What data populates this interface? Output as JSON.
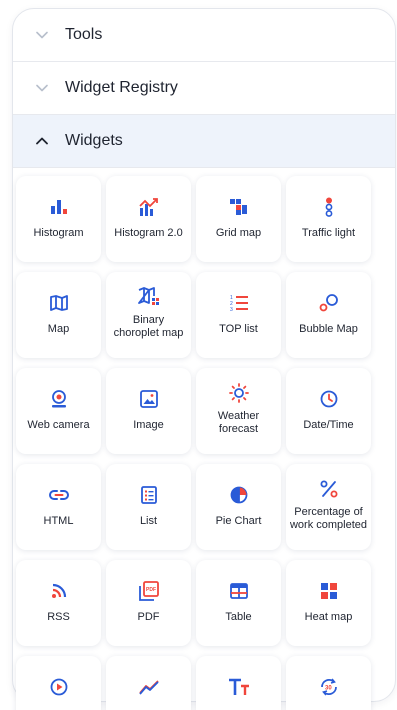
{
  "sections": {
    "tools": {
      "label": "Tools",
      "expanded": false
    },
    "registry": {
      "label": "Widget Registry",
      "expanded": false
    },
    "widgets": {
      "label": "Widgets",
      "expanded": true
    }
  },
  "colors": {
    "blue": "#2a5bd7",
    "red": "#f0463c",
    "header_active": "#eef3fb"
  },
  "widgets": [
    {
      "label": "Histogram",
      "icon": "histogram-icon"
    },
    {
      "label": "Histogram 2.0",
      "icon": "histogram-trend-icon"
    },
    {
      "label": "Grid map",
      "icon": "grid-map-icon"
    },
    {
      "label": "Traffic light",
      "icon": "traffic-light-icon"
    },
    {
      "label": "Map",
      "icon": "map-icon"
    },
    {
      "label": "Binary choroplet map",
      "icon": "choropleth-map-icon"
    },
    {
      "label": "TOP list",
      "icon": "top-list-icon"
    },
    {
      "label": "Bubble Map",
      "icon": "bubble-map-icon"
    },
    {
      "label": "Web camera",
      "icon": "web-camera-icon"
    },
    {
      "label": "Image",
      "icon": "image-icon"
    },
    {
      "label": "Weather forecast",
      "icon": "sun-icon"
    },
    {
      "label": "Date/Time",
      "icon": "clock-icon"
    },
    {
      "label": "HTML",
      "icon": "link-icon"
    },
    {
      "label": "List",
      "icon": "list-icon"
    },
    {
      "label": "Pie Chart",
      "icon": "pie-chart-icon"
    },
    {
      "label": "Percentage of work completed",
      "icon": "percent-icon"
    },
    {
      "label": "RSS",
      "icon": "rss-icon"
    },
    {
      "label": "PDF",
      "icon": "pdf-icon"
    },
    {
      "label": "Table",
      "icon": "table-icon"
    },
    {
      "label": "Heat map",
      "icon": "heat-map-icon"
    },
    {
      "label": "",
      "icon": "play-icon"
    },
    {
      "label": "",
      "icon": "line-chart-icon"
    },
    {
      "label": "",
      "icon": "text-size-icon"
    },
    {
      "label": "",
      "icon": "refresh-30-icon"
    }
  ]
}
